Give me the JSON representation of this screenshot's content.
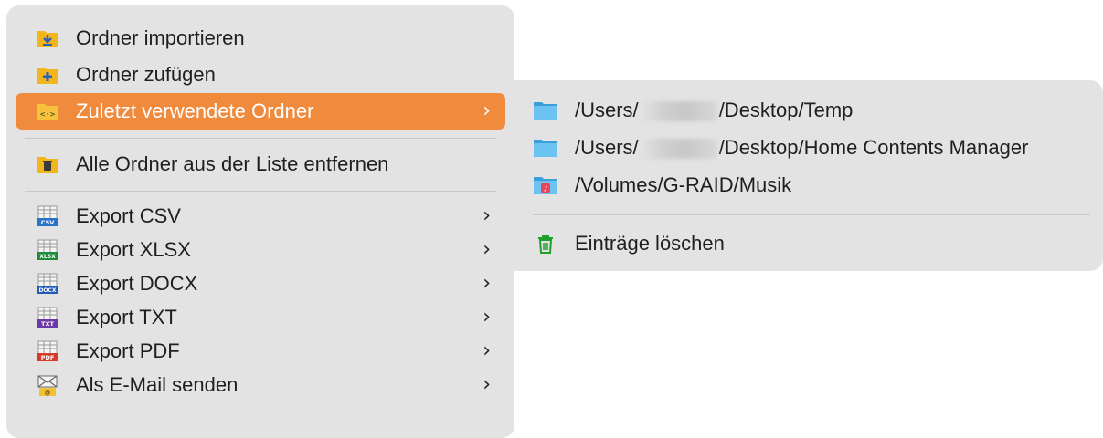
{
  "menu": {
    "items": [
      {
        "label": "Ordner importieren",
        "icon": "folder-import-icon"
      },
      {
        "label": "Ordner zufügen",
        "icon": "folder-add-icon"
      },
      {
        "label": "Zuletzt verwendete Ordner",
        "icon": "folder-code-icon",
        "highlighted": true
      },
      {
        "label": "Alle Ordner aus der Liste entfernen",
        "icon": "folder-trash-icon"
      },
      {
        "label": "Export CSV",
        "icon": "csv-file-icon",
        "badge": "CSV"
      },
      {
        "label": "Export XLSX",
        "icon": "xlsx-file-icon",
        "badge": "XLSX"
      },
      {
        "label": "Export DOCX",
        "icon": "docx-file-icon",
        "badge": "DOCX"
      },
      {
        "label": "Export TXT",
        "icon": "txt-file-icon",
        "badge": "TXT"
      },
      {
        "label": "Export PDF",
        "icon": "pdf-file-icon",
        "badge": "PDF"
      },
      {
        "label": "Als E-Mail senden",
        "icon": "email-icon"
      }
    ]
  },
  "submenu": {
    "items": [
      {
        "prefix": "/Users/",
        "suffix": "/Desktop/Temp",
        "icon": "folder-icon"
      },
      {
        "prefix": "/Users/",
        "suffix": "/Desktop/Home Contents Manager",
        "icon": "folder-icon"
      },
      {
        "label": "/Volumes/G-RAID/Musik",
        "icon": "music-folder-icon"
      }
    ],
    "clear_label": "Einträge löschen"
  },
  "colors": {
    "highlight": "#f08a3c",
    "menu_bg": "#e3e3e3",
    "folder_yellow": "#f2b51c",
    "folder_blue": "#5cb8ec",
    "trash_green": "#21a02e"
  }
}
